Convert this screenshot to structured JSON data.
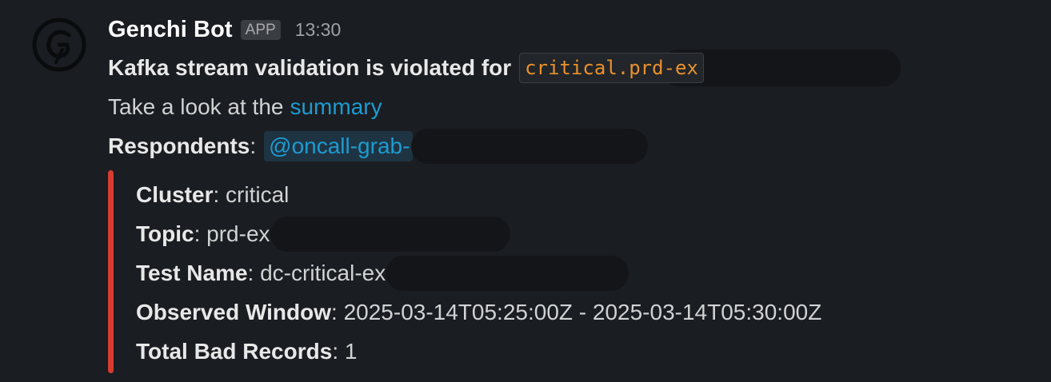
{
  "message": {
    "bot_name": "Genchi Bot",
    "badge": "APP",
    "timestamp": "13:30",
    "avatar_icon": "genchi-logo-icon",
    "headline": {
      "text": "Kafka stream validation is violated for",
      "code_value": "critical.prd-ex"
    },
    "summary_line": {
      "prefix": "Take a look at the",
      "link_text": "summary"
    },
    "respondents": {
      "label": "Respondents",
      "separator": ":",
      "mention": "@oncall-grab-"
    }
  },
  "attachment": {
    "bar_color": "#d63c2f",
    "fields": [
      {
        "label": "Cluster",
        "separator": ": ",
        "value": "critical"
      },
      {
        "label": "Topic",
        "separator": ": ",
        "value": "prd-ex"
      },
      {
        "label": "Test Name",
        "separator": ": ",
        "value": "dc-critical-ex"
      },
      {
        "label": "Observed Window",
        "separator": ": ",
        "value": "2025-03-14T05:25:00Z - 2025-03-14T05:30:00Z"
      },
      {
        "label": "Total Bad Records",
        "separator": ": ",
        "value": "1"
      }
    ]
  },
  "colors": {
    "background": "#1a1d21",
    "link": "#1d9bd1",
    "code_text": "#e8912d",
    "redaction": "#141518"
  }
}
